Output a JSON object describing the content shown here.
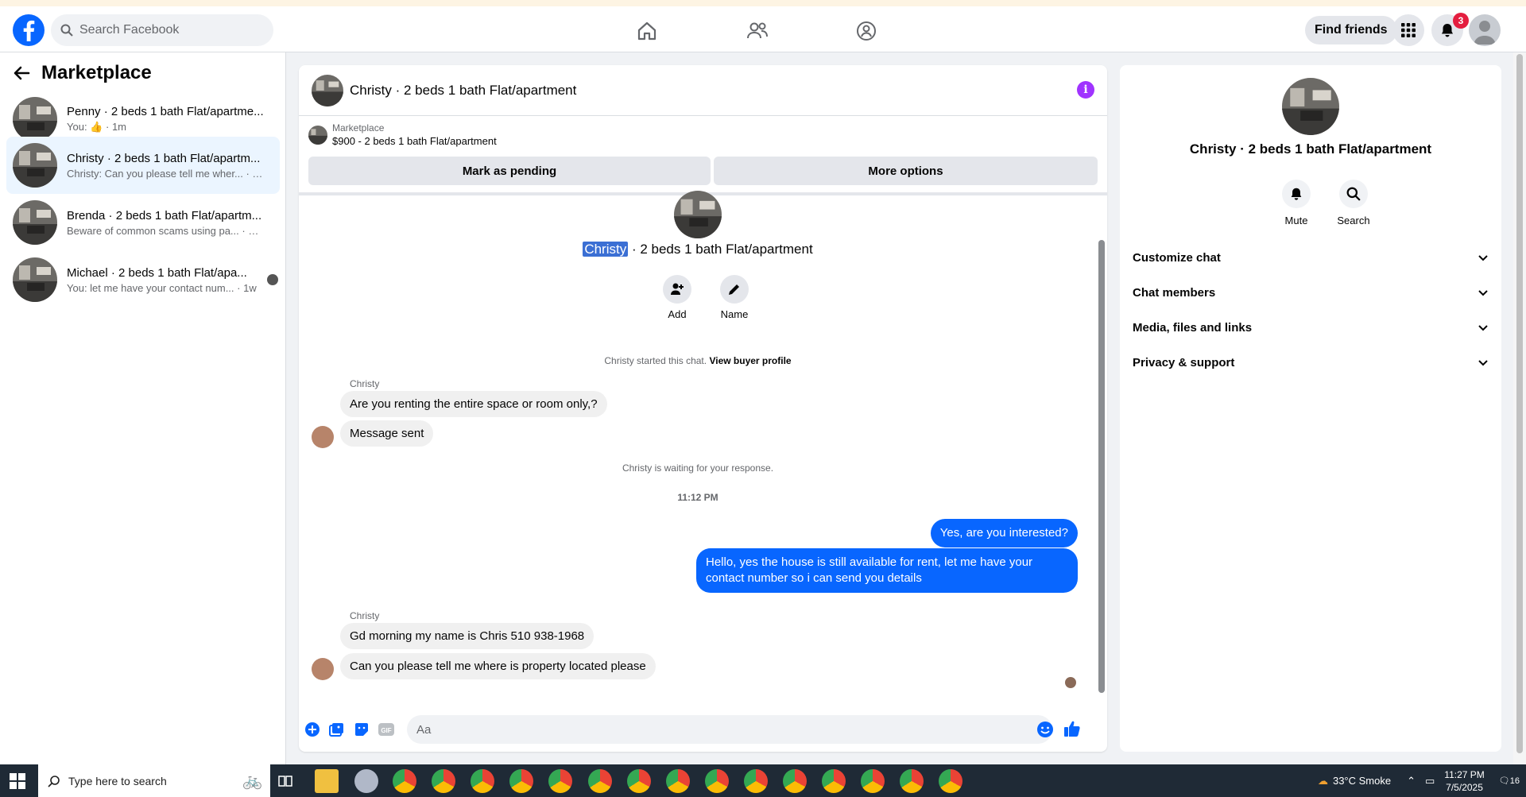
{
  "topbar": {
    "search_placeholder": "Search Facebook",
    "find_friends": "Find friends",
    "notification_count": "3"
  },
  "sidebar": {
    "title": "Marketplace",
    "conversations": [
      {
        "title": "Penny · 2 beds 1 bath Flat/apartme...",
        "preview": "You:",
        "time": "· 1m"
      },
      {
        "title": "Christy · 2 beds 1 bath Flat/apartm...",
        "preview": "Christy: Can you please tell me wher...",
        "time": "· 12m"
      },
      {
        "title": "Brenda · 2 beds 1 bath Flat/apartm...",
        "preview": "Beware of common scams using pa...",
        "time": "· 14m"
      },
      {
        "title": "Michael · 2 beds 1 bath Flat/apa...",
        "preview": "You: let me have your contact num...",
        "time": "· 1w"
      }
    ]
  },
  "chat": {
    "header_title": "Christy · 2 beds 1 bath Flat/apartment",
    "listing_source": "Marketplace",
    "listing_price": "$900 - 2 beds 1 bath Flat/apartment",
    "mark_pending": "Mark as pending",
    "more_options": "More options",
    "intro_name": "Christy",
    "intro_rest": " · 2 beds 1 bath Flat/apartment",
    "add_label": "Add",
    "name_label": "Name",
    "started_text": "Christy started this chat.",
    "view_buyer": "View buyer profile",
    "sender1": "Christy",
    "msg1": "Are you renting the entire space or room only,?",
    "msg2": "Message sent",
    "waiting": "Christy is waiting for your response.",
    "timestamp": "11:12 PM",
    "out1": "Yes, are you interested?",
    "out2": "Hello, yes the house is still available for rent, let me have your contact number so i can send you details",
    "sender2": "Christy",
    "msg3": "Gd morning my name is Chris 510 938-1968",
    "msg4": "Can you please tell me where is property located please",
    "composer_placeholder": "Aa"
  },
  "right": {
    "title": "Christy · 2 beds 1 bath Flat/apartment",
    "mute": "Mute",
    "search": "Search",
    "sections": [
      "Customize chat",
      "Chat members",
      "Media, files and links",
      "Privacy & support"
    ]
  },
  "taskbar": {
    "search_placeholder": "Type here to search",
    "weather": "33°C  Smoke",
    "time": "11:27 PM",
    "date": "7/5/2025",
    "notif_count": "16"
  },
  "colors": {
    "brand": "#0866ff",
    "info": "#a033ff",
    "badge": "#e41e3f"
  }
}
